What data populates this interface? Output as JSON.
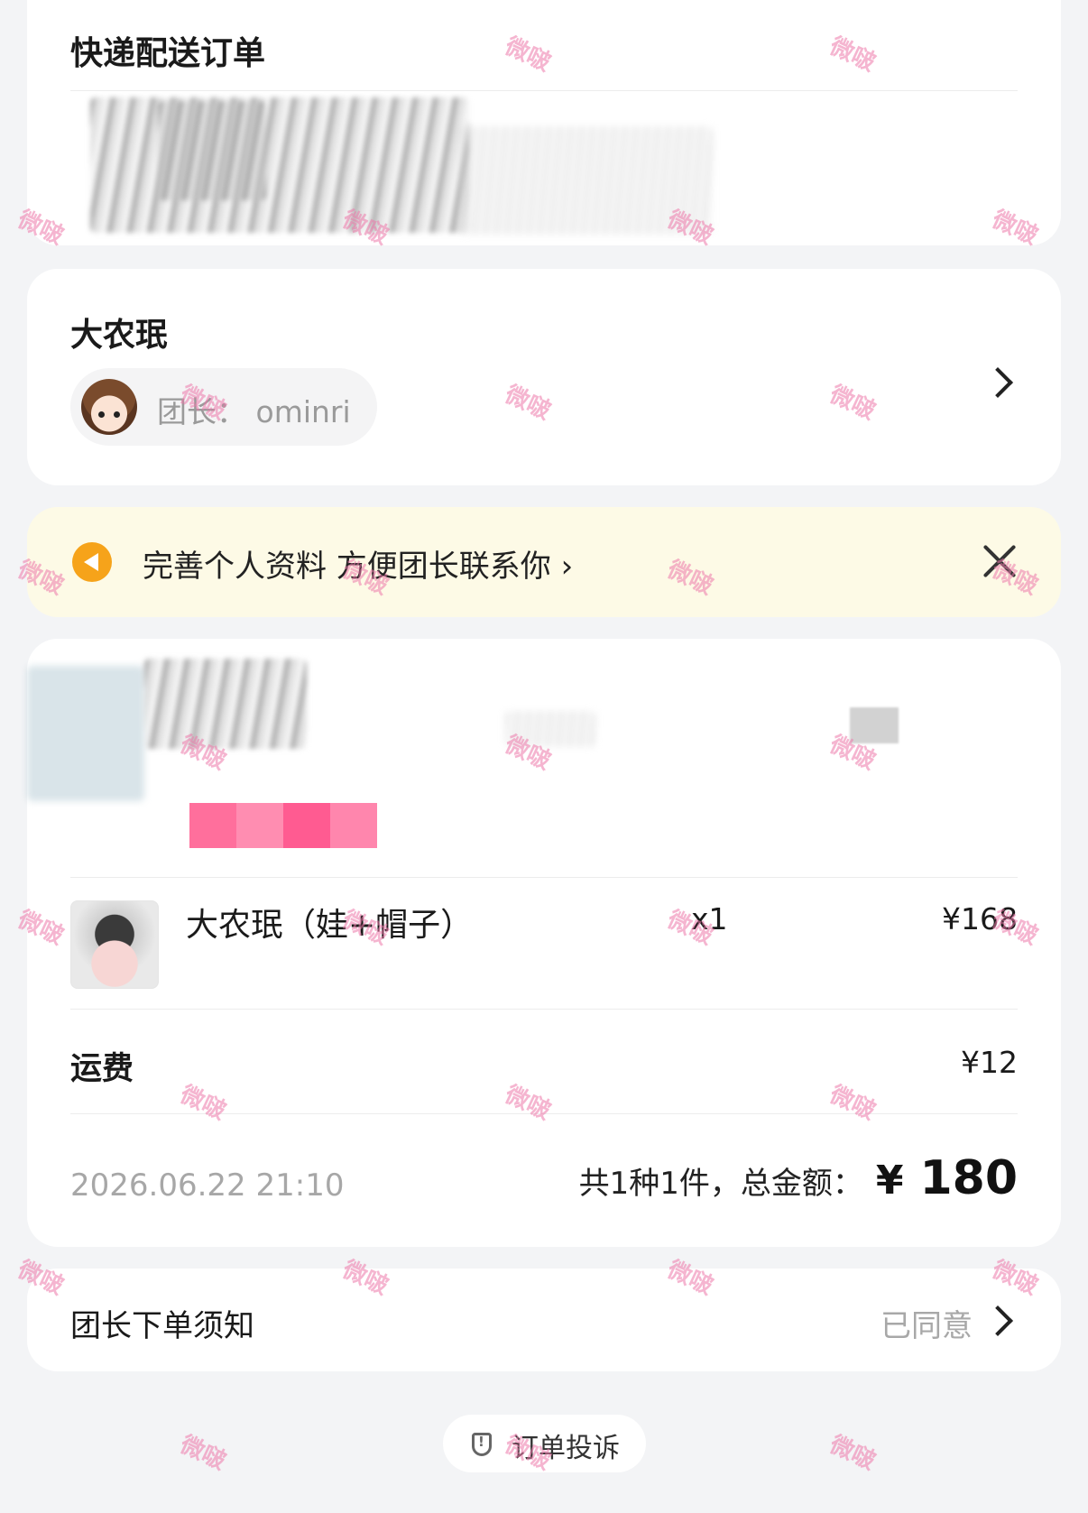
{
  "delivery": {
    "title": "快递配送订单"
  },
  "group": {
    "name": "大农珉",
    "leader_label": "团长：",
    "leader_name": "ominri"
  },
  "notice": {
    "text": "完善个人资料 方便团长联系你 ›"
  },
  "order": {
    "product": {
      "name": "大农珉（娃+帽子）",
      "quantity": "x1",
      "price": "¥168"
    },
    "shipping": {
      "label": "运费",
      "value": "¥12"
    },
    "date": "2026.06.22 21:10",
    "summary_text": "共1种1件，总金额：",
    "currency": "¥",
    "total": "180",
    "strip_colors": [
      "#ff6f9c",
      "#ff8db1",
      "#ff5b91",
      "#ff86ad"
    ]
  },
  "rules": {
    "label": "团长下单须知",
    "status": "已同意"
  },
  "complaint": {
    "label": "订单投诉"
  },
  "watermark": {
    "text": "微啵"
  },
  "icons": {
    "notice": "megaphone-icon",
    "close": "close-icon",
    "chevron": "chevron-right-icon",
    "shield": "shield-icon"
  }
}
